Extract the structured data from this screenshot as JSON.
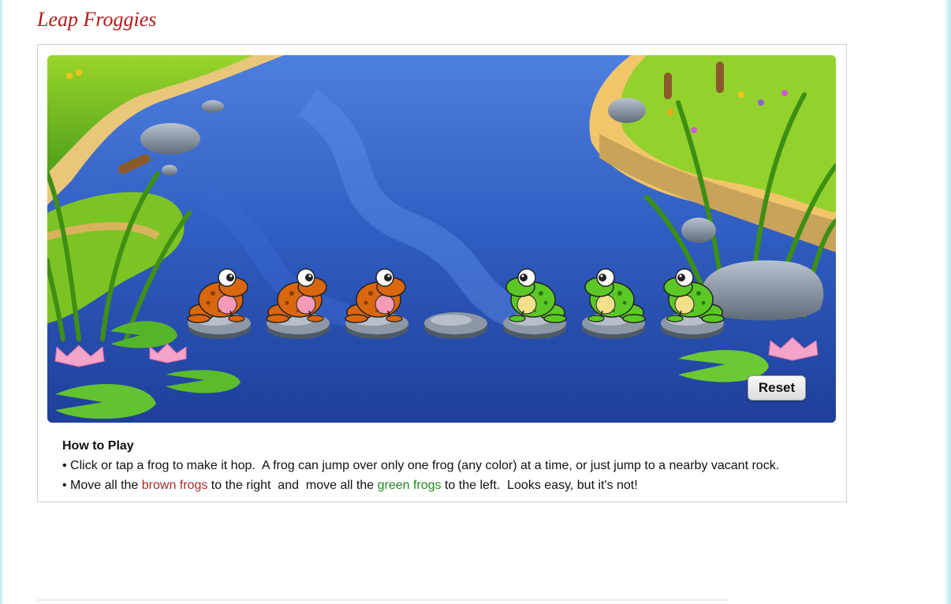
{
  "page": {
    "title": "Leap Froggies"
  },
  "game": {
    "rocks": [
      {
        "occupant": "brown"
      },
      {
        "occupant": "brown"
      },
      {
        "occupant": "brown"
      },
      {
        "occupant": "empty"
      },
      {
        "occupant": "green"
      },
      {
        "occupant": "green"
      },
      {
        "occupant": "green"
      }
    ],
    "reset_label": "Reset"
  },
  "instructions": {
    "heading": "How to Play",
    "line1": "• Click or tap a frog to make it hop.  A frog can jump over only one frog (any color) at a time, or just jump to a nearby vacant rock.",
    "line2_part1": "• Move all the ",
    "line2_brown": "brown frogs",
    "line2_part2": " to the right  and  move all the ",
    "line2_green": "green frogs",
    "line2_part3": " to the left.  Looks easy, but it's not!"
  },
  "colors": {
    "title": "#b31b1b",
    "brown_text": "#a52a2a",
    "green_text": "#1e8a1e",
    "brown_frog": "#d9670f",
    "green_frog": "#5cc825",
    "water": "#2f5fc0"
  }
}
